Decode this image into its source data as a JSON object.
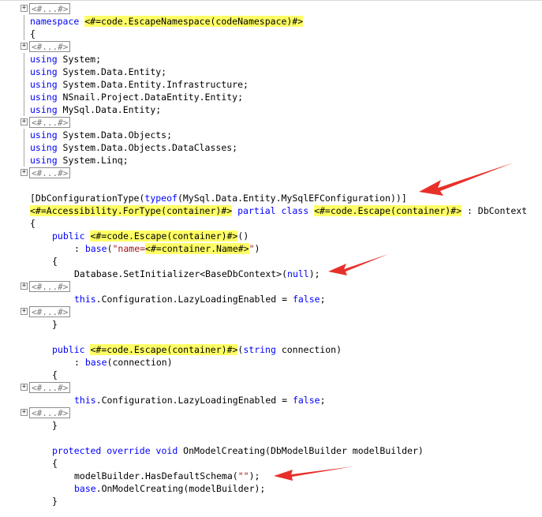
{
  "editor": {
    "collapsed_label": "<#...#>",
    "fold_symbol": "⊞",
    "lines": [
      {
        "type": "collapsed"
      },
      {
        "type": "code",
        "indent": 0,
        "tokens": [
          [
            "kw",
            "namespace"
          ],
          [
            "t",
            " "
          ],
          [
            "tt",
            "<#=code.EscapeNamespace(codeNamespace)#>"
          ]
        ]
      },
      {
        "type": "code",
        "indent": 0,
        "tokens": [
          [
            "t",
            "{"
          ]
        ]
      },
      {
        "type": "collapsed"
      },
      {
        "type": "code",
        "indent": 0,
        "tokens": [
          [
            "kw",
            "using"
          ],
          [
            "t",
            " System;"
          ]
        ]
      },
      {
        "type": "code",
        "indent": 0,
        "tokens": [
          [
            "kw",
            "using"
          ],
          [
            "t",
            " System.Data.Entity;"
          ]
        ]
      },
      {
        "type": "code",
        "indent": 0,
        "tokens": [
          [
            "kw",
            "using"
          ],
          [
            "t",
            " System.Data.Entity.Infrastructure;"
          ]
        ]
      },
      {
        "type": "code",
        "indent": 0,
        "tokens": [
          [
            "kw",
            "using"
          ],
          [
            "t",
            " NSnail.Project.DataEntity.Entity;"
          ]
        ]
      },
      {
        "type": "code",
        "indent": 0,
        "tokens": [
          [
            "kw",
            "using"
          ],
          [
            "t",
            " MySql.Data.Entity;"
          ]
        ]
      },
      {
        "type": "collapsed"
      },
      {
        "type": "code",
        "indent": 0,
        "tokens": [
          [
            "kw",
            "using"
          ],
          [
            "t",
            " System.Data.Objects;"
          ]
        ]
      },
      {
        "type": "code",
        "indent": 0,
        "tokens": [
          [
            "kw",
            "using"
          ],
          [
            "t",
            " System.Data.Objects.DataClasses;"
          ]
        ]
      },
      {
        "type": "code",
        "indent": 0,
        "tokens": [
          [
            "kw",
            "using"
          ],
          [
            "t",
            " System.Linq;"
          ]
        ]
      },
      {
        "type": "collapsed"
      },
      {
        "type": "blank"
      },
      {
        "type": "code",
        "indent": 0,
        "tokens": [
          [
            "t",
            "[DbConfigurationType("
          ],
          [
            "kw",
            "typeof"
          ],
          [
            "t",
            "(MySql.Data.Entity.MySqlEFConfiguration))]"
          ]
        ]
      },
      {
        "type": "code",
        "indent": 0,
        "tokens": [
          [
            "tt",
            "<#=Accessibility.ForType(container)#>"
          ],
          [
            "t",
            " "
          ],
          [
            "kw",
            "partial class"
          ],
          [
            "t",
            " "
          ],
          [
            "tt",
            "<#=code.Escape(container)#>"
          ],
          [
            "t",
            " : DbContext"
          ]
        ]
      },
      {
        "type": "code",
        "indent": 0,
        "tokens": [
          [
            "t",
            "{"
          ]
        ]
      },
      {
        "type": "code",
        "indent": 1,
        "tokens": [
          [
            "kw",
            "public"
          ],
          [
            "t",
            " "
          ],
          [
            "tt",
            "<#=code.Escape(container)#>"
          ],
          [
            "t",
            "()"
          ]
        ]
      },
      {
        "type": "code",
        "indent": 2,
        "tokens": [
          [
            "t",
            ": "
          ],
          [
            "kw",
            "base"
          ],
          [
            "t",
            "("
          ],
          [
            "str",
            "\"name="
          ],
          [
            "tt",
            "<#=container.Name#>"
          ],
          [
            "str",
            "\""
          ],
          [
            "t",
            ")"
          ]
        ]
      },
      {
        "type": "code",
        "indent": 1,
        "tokens": [
          [
            "t",
            "{"
          ]
        ]
      },
      {
        "type": "code",
        "indent": 2,
        "tokens": [
          [
            "t",
            "Database.SetInitializer<BaseDbContext>("
          ],
          [
            "kw",
            "null"
          ],
          [
            "t",
            ");"
          ]
        ]
      },
      {
        "type": "collapsed"
      },
      {
        "type": "code",
        "indent": 2,
        "tokens": [
          [
            "kw",
            "this"
          ],
          [
            "t",
            ".Configuration.LazyLoadingEnabled = "
          ],
          [
            "kw",
            "false"
          ],
          [
            "t",
            ";"
          ]
        ]
      },
      {
        "type": "collapsed"
      },
      {
        "type": "code",
        "indent": 1,
        "tokens": [
          [
            "t",
            "}"
          ]
        ]
      },
      {
        "type": "blank"
      },
      {
        "type": "code",
        "indent": 1,
        "tokens": [
          [
            "kw",
            "public"
          ],
          [
            "t",
            " "
          ],
          [
            "tt",
            "<#=code.Escape(container)#>"
          ],
          [
            "t",
            "("
          ],
          [
            "kw",
            "string"
          ],
          [
            "t",
            " connection)"
          ]
        ]
      },
      {
        "type": "code",
        "indent": 2,
        "tokens": [
          [
            "t",
            ": "
          ],
          [
            "kw",
            "base"
          ],
          [
            "t",
            "(connection)"
          ]
        ]
      },
      {
        "type": "code",
        "indent": 1,
        "tokens": [
          [
            "t",
            "{"
          ]
        ]
      },
      {
        "type": "collapsed"
      },
      {
        "type": "code",
        "indent": 2,
        "tokens": [
          [
            "kw",
            "this"
          ],
          [
            "t",
            ".Configuration.LazyLoadingEnabled = "
          ],
          [
            "kw",
            "false"
          ],
          [
            "t",
            ";"
          ]
        ]
      },
      {
        "type": "collapsed"
      },
      {
        "type": "code",
        "indent": 1,
        "tokens": [
          [
            "t",
            "}"
          ]
        ]
      },
      {
        "type": "blank"
      },
      {
        "type": "code",
        "indent": 1,
        "tokens": [
          [
            "kw",
            "protected override void"
          ],
          [
            "t",
            " OnModelCreating(DbModelBuilder modelBuilder)"
          ]
        ]
      },
      {
        "type": "code",
        "indent": 1,
        "tokens": [
          [
            "t",
            "{"
          ]
        ]
      },
      {
        "type": "code",
        "indent": 2,
        "tokens": [
          [
            "t",
            "modelBuilder.HasDefaultSchema("
          ],
          [
            "str",
            "\"\""
          ],
          [
            "t",
            ");"
          ]
        ]
      },
      {
        "type": "code",
        "indent": 2,
        "tokens": [
          [
            "kw",
            "base"
          ],
          [
            "t",
            ".OnModelCreating(modelBuilder);"
          ]
        ]
      },
      {
        "type": "code",
        "indent": 1,
        "tokens": [
          [
            "t",
            "}"
          ]
        ]
      }
    ]
  },
  "annotations": {
    "arrow_color": "#e8302a",
    "count": 3
  }
}
